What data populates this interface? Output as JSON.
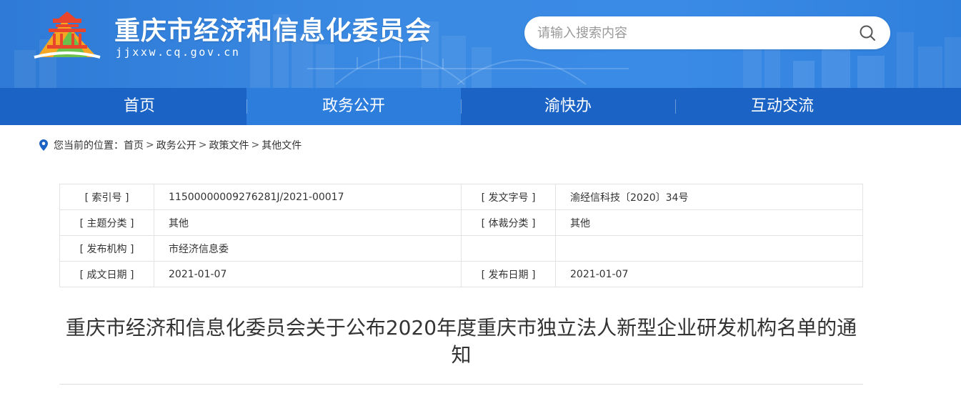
{
  "header": {
    "site_title": "重庆市经济和信息化委员会",
    "site_domain": "jjxxw.cq.gov.cn",
    "search_placeholder": "请输入搜索内容",
    "search_icon": "search-icon",
    "logo_icon": "emblem-logo-icon",
    "colors": {
      "banner": "#3a8ae3",
      "nav": "#1b63c4",
      "nav_active": "#2d7ddd"
    }
  },
  "nav": {
    "items": [
      {
        "label": "首页"
      },
      {
        "label": "政务公开",
        "active": true
      },
      {
        "label": "渝快办"
      },
      {
        "label": "互动交流"
      }
    ]
  },
  "breadcrumb": {
    "icon": "location-pin-icon",
    "prefix": "您当前的位置：",
    "items": [
      "首页",
      "政务公开",
      "政策文件",
      "其他文件"
    ],
    "separator": ">"
  },
  "info": {
    "rows": [
      {
        "l1": "[ 索引号 ]",
        "v1": "11500000009276281J/2021-00017",
        "l2": "[ 发文字号 ]",
        "v2": "渝经信科技〔2020〕34号"
      },
      {
        "l1": "[ 主题分类 ]",
        "v1": "其他",
        "l2": "[ 体裁分类 ]",
        "v2": "其他"
      },
      {
        "l1": "[ 发布机构 ]",
        "v1": "市经济信息委",
        "l2": "",
        "v2": ""
      },
      {
        "l1": "[ 成文日期 ]",
        "v1": "2021-01-07",
        "l2": "[ 发布日期 ]",
        "v2": "2021-01-07"
      }
    ]
  },
  "article": {
    "title": "重庆市经济和信息化委员会关于公布2020年度重庆市独立法人新型企业研发机构名单的通知"
  }
}
